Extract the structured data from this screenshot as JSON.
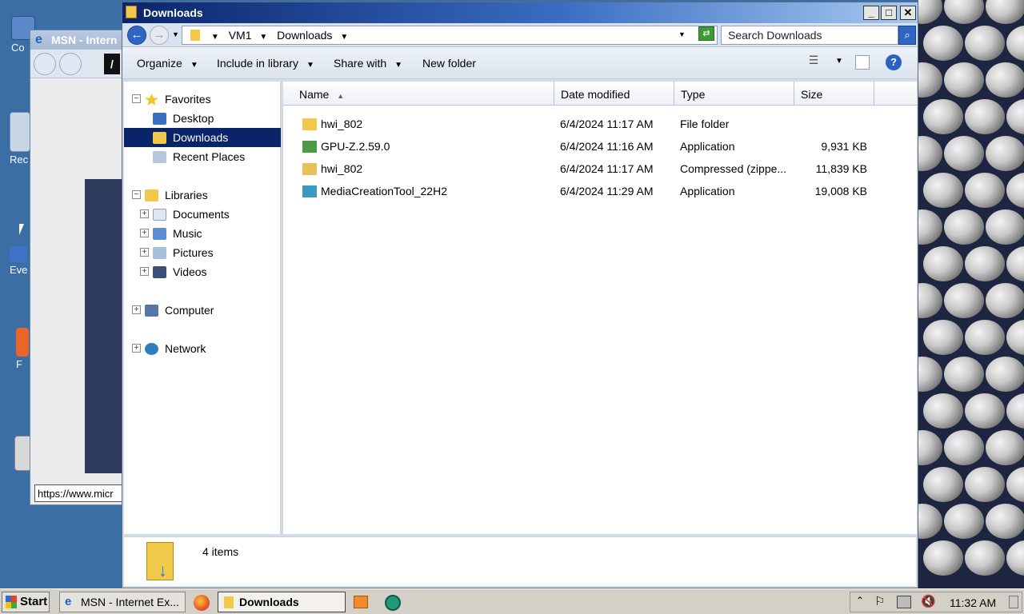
{
  "desktop": {
    "icons": [
      {
        "label": "Co",
        "name": "computer-desktop-icon"
      },
      {
        "label": "Rec",
        "name": "recycle-bin-desktop-icon"
      },
      {
        "label": "Eve",
        "name": "event-desktop-icon"
      },
      {
        "label": "F",
        "name": "firefox-desktop-icon"
      }
    ]
  },
  "ie_window": {
    "title": "MSN - Intern",
    "url_tooltip": "https://www.micr"
  },
  "explorer": {
    "title": "Downloads",
    "address": {
      "segments": [
        "VM1",
        "Downloads"
      ]
    },
    "search_placeholder": "Search Downloads",
    "toolbar": {
      "organize": "Organize",
      "include_in_library": "Include in library",
      "share_with": "Share with",
      "new_folder": "New folder"
    },
    "nav": {
      "favorites": "Favorites",
      "desktop": "Desktop",
      "downloads": "Downloads",
      "recent_places": "Recent Places",
      "libraries": "Libraries",
      "documents": "Documents",
      "music": "Music",
      "pictures": "Pictures",
      "videos": "Videos",
      "computer": "Computer",
      "network": "Network"
    },
    "columns": {
      "name": "Name",
      "date": "Date modified",
      "type": "Type",
      "size": "Size"
    },
    "files": [
      {
        "name": "hwi_802",
        "date": "6/4/2024 11:17 AM",
        "type": "File folder",
        "size": ""
      },
      {
        "name": "GPU-Z.2.59.0",
        "date": "6/4/2024 11:16 AM",
        "type": "Application",
        "size": "9,931 KB"
      },
      {
        "name": "hwi_802",
        "date": "6/4/2024 11:17 AM",
        "type": "Compressed (zippe...",
        "size": "11,839 KB"
      },
      {
        "name": "MediaCreationTool_22H2",
        "date": "6/4/2024 11:29 AM",
        "type": "Application",
        "size": "19,008 KB"
      }
    ],
    "status": "4 items"
  },
  "taskbar": {
    "start": "Start",
    "tasks": [
      "MSN - Internet Ex...",
      "Downloads"
    ],
    "clock": "11:32 AM"
  }
}
